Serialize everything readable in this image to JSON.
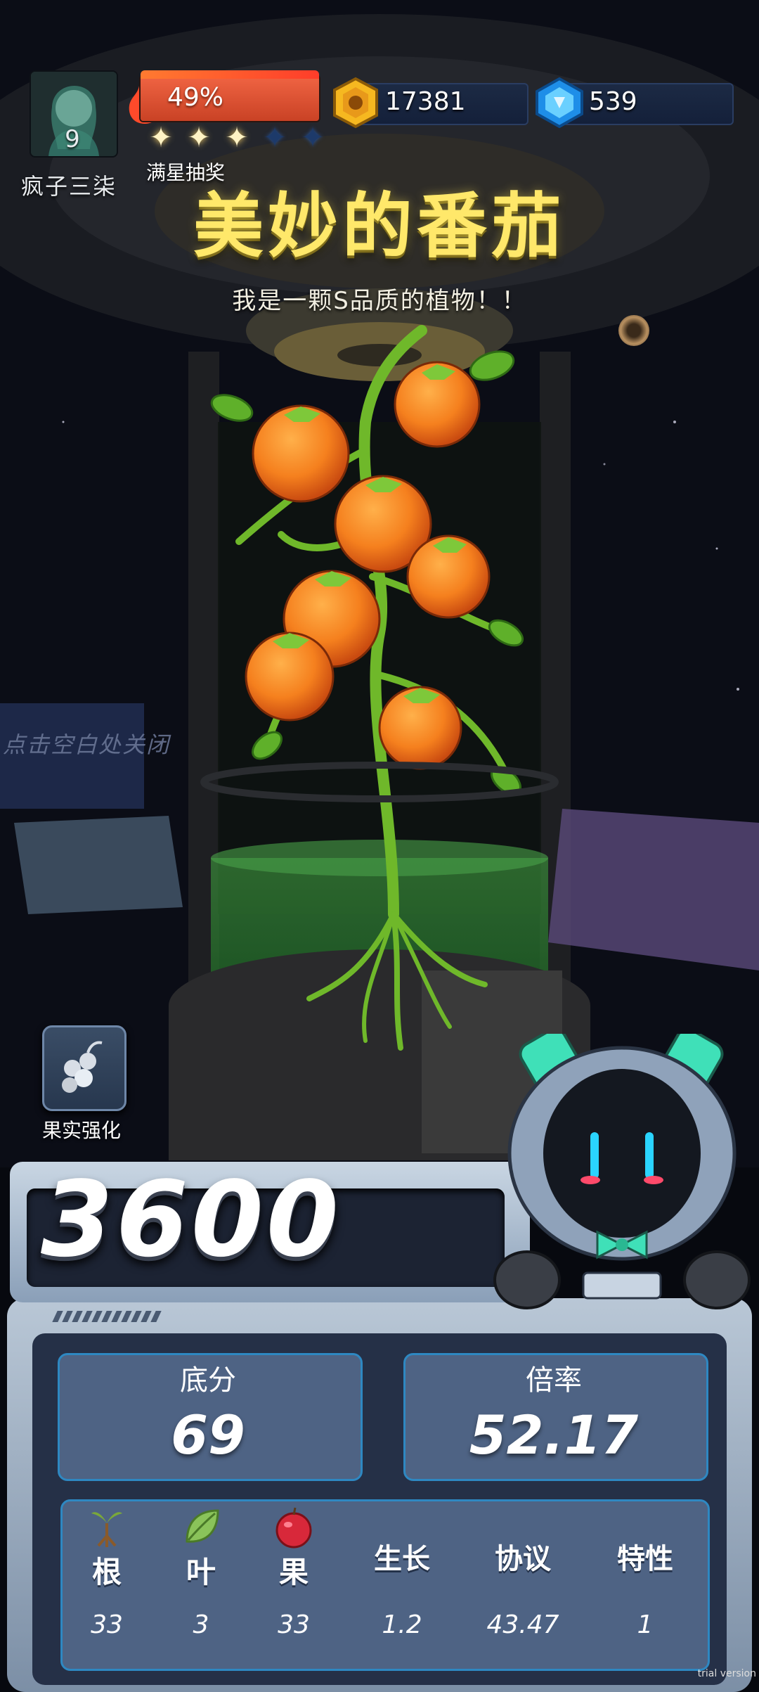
{
  "player": {
    "name": "疯子三柒",
    "level": "9",
    "energy_pct": "49%",
    "stars_filled": 3,
    "stars_total": 5,
    "lottery_label": "满星抽奖"
  },
  "resources": {
    "coins": "17381",
    "gems": "539"
  },
  "plant": {
    "title": "美妙的番茄",
    "subtitle": "我是一颗S品质的植物！！"
  },
  "close_hint": "点击空白处关闭",
  "fruit_button_label": "果实强化",
  "score": "3600",
  "stats": {
    "base_label": "底分",
    "base_value": "69",
    "mult_label": "倍率",
    "mult_value": "52.17"
  },
  "attributes": [
    {
      "name": "根",
      "value": "33",
      "icon": "root-icon"
    },
    {
      "name": "叶",
      "value": "3",
      "icon": "leaf-icon"
    },
    {
      "name": "果",
      "value": "33",
      "icon": "apple-icon"
    },
    {
      "name": "生长",
      "value": "1.2"
    },
    {
      "name": "协议",
      "value": "43.47"
    },
    {
      "name": "特性",
      "value": "1"
    }
  ],
  "watermark": "trial version",
  "colors": {
    "title": "#ffe86a",
    "card": "#4e6384",
    "card_border": "#2e88c2",
    "energy": "#f06443"
  }
}
